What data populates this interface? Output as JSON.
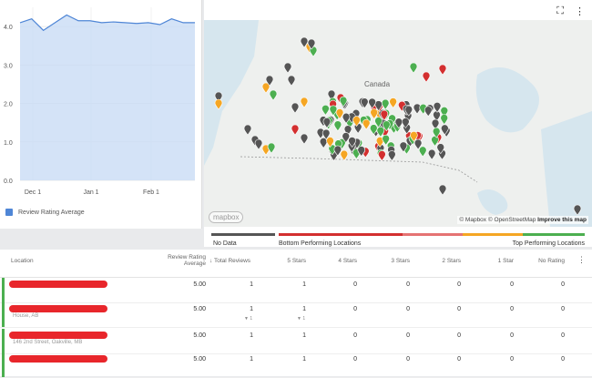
{
  "chart": {
    "y_ticks": [
      "4.0",
      "3.0",
      "2.0",
      "1.0",
      "0.0"
    ],
    "x_ticks": [
      "Dec 1",
      "Jan 1",
      "Feb 1"
    ],
    "legend_label": "Review Rating Average",
    "series_color": "#4f86d6"
  },
  "chart_data": {
    "type": "area",
    "x": [
      "Nov 18",
      "Nov 25",
      "Dec 1",
      "Dec 8",
      "Dec 15",
      "Dec 22",
      "Dec 29",
      "Jan 5",
      "Jan 12",
      "Jan 19",
      "Jan 26",
      "Feb 2",
      "Feb 9",
      "Feb 16",
      "Feb 23",
      "Mar 2"
    ],
    "series": [
      {
        "values": [
          4.1,
          4.2,
          3.9,
          4.1,
          4.3,
          4.15,
          4.15,
          4.1,
          4.12,
          4.1,
          4.08,
          4.1,
          4.05,
          4.2,
          4.1,
          4.1
        ]
      }
    ],
    "ylim": [
      0,
      4.5
    ],
    "grid": true,
    "legend_position": "bottom-left"
  },
  "map": {
    "fullscreen_icon": "⛶",
    "more_icon": "⋮",
    "country_label": "Canada",
    "attribution_mapbox": "© Mapbox",
    "attribution_osm": "© OpenStreetMap",
    "attribution_improve": "Improve this map",
    "logo": "mapbox",
    "legend": {
      "no_data": "No Data",
      "bottom": "Bottom Performing Locations",
      "top": "Top Performing Locations",
      "colors": {
        "no_data": "#555555",
        "red": "#d32f2f",
        "yellow": "#f5a623",
        "green": "#4caf50"
      }
    }
  },
  "table": {
    "headers": {
      "location": "Location",
      "rating": "Review Rating",
      "rating2": "Average",
      "total": "Total Reviews",
      "s5": "5 Stars",
      "s4": "4 Stars",
      "s3": "3 Stars",
      "s2": "2 Stars",
      "s1": "1 Star",
      "none": "No Rating"
    },
    "sort_icon": "↓",
    "rows": [
      {
        "addr": "",
        "rating": "5.00",
        "total": "1",
        "s5": "1",
        "s4": "0",
        "s3": "0",
        "s2": "0",
        "s1": "0",
        "none": "0"
      },
      {
        "addr": "House, AB",
        "rating": "5.00",
        "total": "1",
        "s5": "1",
        "s4": "0",
        "s3": "0",
        "s2": "0",
        "s1": "0",
        "none": "0",
        "sub_total": "1",
        "sub_s5": "1"
      },
      {
        "addr": "146 2nd Street, Oakville, MB",
        "rating": "5.00",
        "total": "1",
        "s5": "1",
        "s4": "0",
        "s3": "0",
        "s2": "0",
        "s1": "0",
        "none": "0"
      },
      {
        "addr": "",
        "rating": "5.00",
        "total": "1",
        "s5": "1",
        "s4": "0",
        "s3": "0",
        "s2": "0",
        "s1": "0",
        "none": "0"
      }
    ]
  }
}
